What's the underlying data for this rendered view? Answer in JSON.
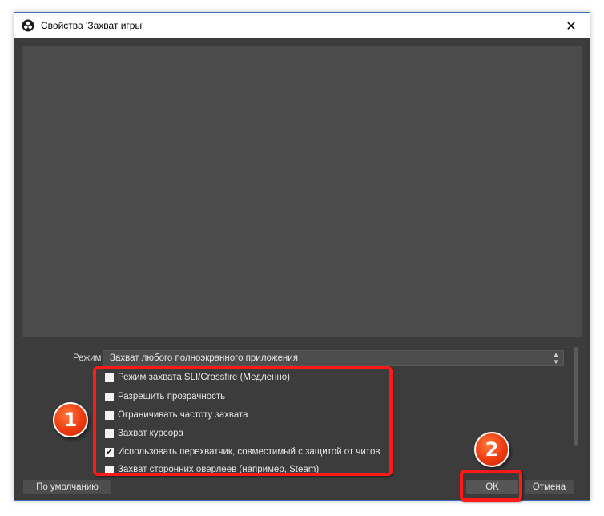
{
  "window": {
    "title": "Свойства 'Захват игры'",
    "close_glyph": "✕"
  },
  "properties": {
    "mode_label": "Режим",
    "mode_value": "Захват любого полноэкранного приложения",
    "options": [
      {
        "label": "Режим захвата SLI/Crossfire (Медленно)",
        "checked": false
      },
      {
        "label": "Разрешить прозрачность",
        "checked": false
      },
      {
        "label": "Ограничивать частоту захвата",
        "checked": false
      },
      {
        "label": "Захват курсора",
        "checked": false
      },
      {
        "label": "Использовать перехватчик, совместимый с защитой от читов",
        "checked": true
      },
      {
        "label": "Захват сторонних оверлеев (например, Steam)",
        "checked": false
      }
    ]
  },
  "buttons": {
    "defaults": "По умолчанию",
    "ok": "OK",
    "cancel": "Отмена"
  },
  "annotations": {
    "badge1": "1",
    "badge2": "2",
    "highlight_color": "#ff1a1a",
    "badge_color": "#ee3a10"
  },
  "checkmark_glyph": "✔"
}
